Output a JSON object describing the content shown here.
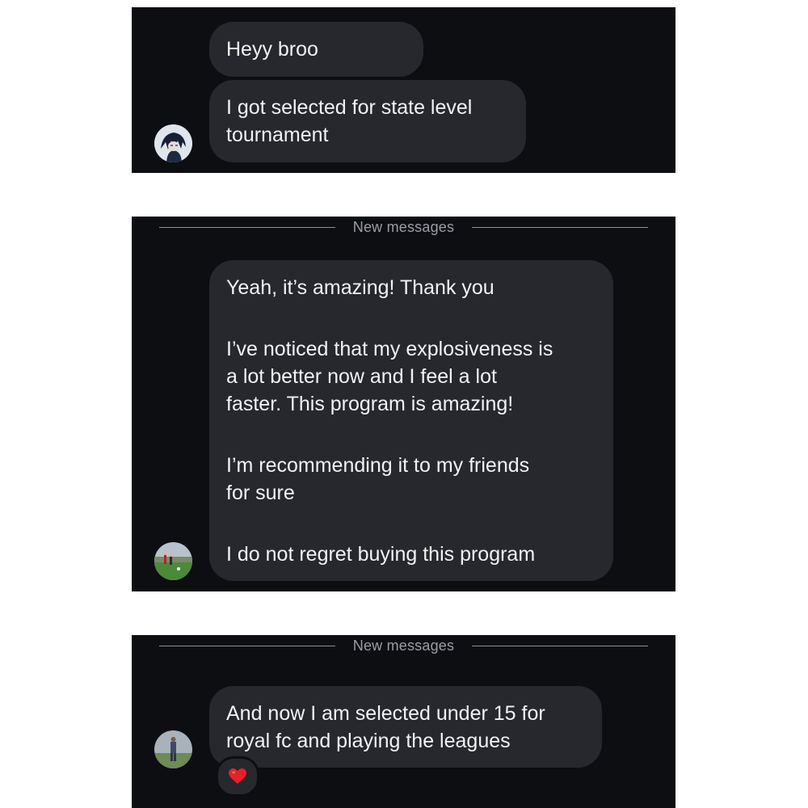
{
  "panel_1": {
    "messages": [
      {
        "text": "Heyy broo"
      },
      {
        "line1": "I got selected for state level",
        "line2": "tournament"
      }
    ]
  },
  "panel_2": {
    "divider_label": "New messages",
    "message": {
      "p1": "Yeah, it’s amazing! Thank you",
      "p2_l1": "I’ve noticed that my explosiveness is",
      "p2_l2": "a lot better now and I feel a lot",
      "p2_l3": "faster. This program is amazing!",
      "p3_l1": "I’m recommending it to my friends",
      "p3_l2": "for sure",
      "p4": "I do not regret buying this program"
    }
  },
  "panel_3": {
    "divider_label": "New messages",
    "message": {
      "line1": "And now I am selected under 15 for",
      "line2": "royal fc and playing the leagues"
    },
    "reaction": "heart-reaction-icon"
  },
  "colors": {
    "chat_background": "#0c0e12",
    "bubble_background": "#26282d",
    "bubble_text": "#f2f2f4",
    "divider_text": "#9a9da4",
    "heart": "#e8202b"
  }
}
